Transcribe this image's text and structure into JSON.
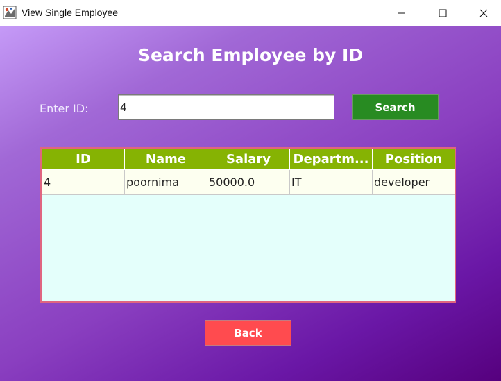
{
  "window": {
    "title": "View Single Employee",
    "app_icon": "java-app-icon",
    "controls": [
      "minimize-icon",
      "maximize-icon",
      "close-icon"
    ]
  },
  "page": {
    "heading": "Search Employee by ID",
    "gradient_colors": [
      "#c59af7",
      "#8a3fc0",
      "#56007e"
    ]
  },
  "search": {
    "label": "Enter ID:",
    "value": "4",
    "button_label": "Search",
    "button_color": "#288b22"
  },
  "table": {
    "columns": [
      "ID",
      "Name",
      "Salary",
      "Departm...",
      "Position"
    ],
    "rows": [
      [
        "4",
        "poornima",
        "50000.0",
        "IT",
        "developer"
      ]
    ],
    "header_color": "#86b303",
    "body_color": "#e4fffb",
    "border_color": "#e06580"
  },
  "back": {
    "label": "Back",
    "color": "#ff4b4f"
  }
}
